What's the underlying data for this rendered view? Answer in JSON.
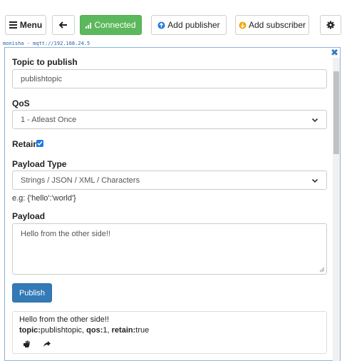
{
  "toolbar": {
    "menu_label": "Menu",
    "connected_label": "Connected",
    "add_publisher_label": "Add publisher",
    "add_subscriber_label": "Add subscriber"
  },
  "connection": {
    "label": "monisha - mqtt://192.168.24.5"
  },
  "publish_form": {
    "topic_label": "Topic to publish",
    "topic_value": "publishtopic",
    "qos_label": "QoS",
    "qos_value": "1 - Atleast Once",
    "retain_label": "Retain",
    "retain_checked": true,
    "payload_type_label": "Payload Type",
    "payload_type_value": "Strings / JSON / XML / Characters",
    "payload_hint": "e.g: {'hello':'world'}",
    "payload_label": "Payload",
    "payload_value": "Hello from the other side!!",
    "publish_label": "Publish"
  },
  "published_message": {
    "text": "Hello from the other side!!",
    "topic_key": "topic:",
    "topic_value": "publishtopic",
    "qos_key": "qos:",
    "qos_value": "1",
    "retain_key": "retain:",
    "retain_value": "true"
  },
  "icons": [
    "hamburger-icon",
    "arrow-left-icon",
    "signal-icon",
    "arrow-up-circle-icon",
    "arrow-down-circle-icon",
    "gear-icon",
    "close-icon",
    "chevron-down-icon",
    "hand-icon",
    "share-arrow-icon"
  ],
  "colors": {
    "connected_green": "#5cb85c",
    "publish_blue": "#337ab7",
    "publisher_icon_blue": "#1f7ae0",
    "subscriber_icon_orange": "#f0a500",
    "close_blue": "#3478c5"
  }
}
